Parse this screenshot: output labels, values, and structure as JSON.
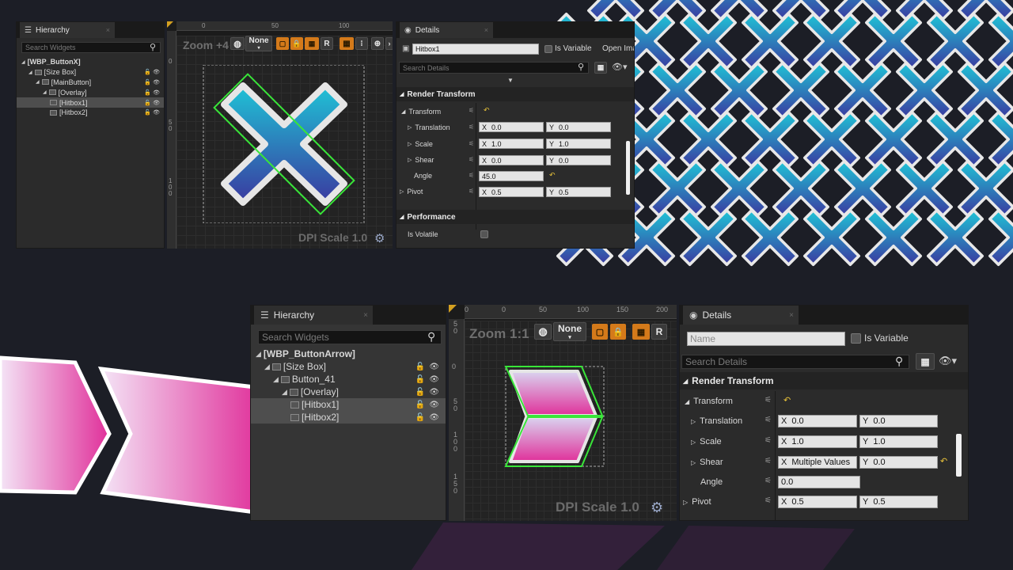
{
  "colors": {
    "accent": "#d47a1a",
    "hitbox": "#39e639",
    "reset": "#e8c23a",
    "x_cyan": "#1fc3d6",
    "x_indigo": "#3a3aa0",
    "arrow_pink": "#e0309a"
  },
  "top": {
    "hierarchy": {
      "tab": "Hierarchy",
      "search_placeholder": "Search Widgets",
      "items": [
        {
          "label": "[WBP_ButtonX]"
        },
        {
          "label": "[Size Box]"
        },
        {
          "label": "[MainButton]"
        },
        {
          "label": "[Overlay]"
        },
        {
          "label": "[Hitbox1]"
        },
        {
          "label": "[Hitbox2]"
        }
      ]
    },
    "designer": {
      "zoom": "Zoom +4",
      "none_label": "None",
      "r_label": "R",
      "ruler_top": [
        "0",
        "50",
        "100"
      ],
      "ruler_left": [
        "0",
        "5\n0",
        "1\n0\n0"
      ],
      "dpi": "DPI Scale 1.0"
    },
    "details": {
      "tab": "Details",
      "name_value": "Hitbox1",
      "is_variable": "Is Variable",
      "open_label": "Open Ima",
      "search_placeholder": "Search Details",
      "section_render": "Render Transform",
      "transform": "Transform",
      "translation": {
        "label": "Translation",
        "x": "0.0",
        "y": "0.0"
      },
      "scale": {
        "label": "Scale",
        "x": "1.0",
        "y": "1.0"
      },
      "shear": {
        "label": "Shear",
        "x": "0.0",
        "y": "0.0"
      },
      "angle": {
        "label": "Angle",
        "value": "45.0"
      },
      "pivot": {
        "label": "Pivot",
        "x": "0.5",
        "y": "0.5"
      },
      "section_performance": "Performance",
      "is_volatile": "Is Volatile",
      "x_axis": "X",
      "y_axis": "Y"
    }
  },
  "bottom": {
    "hierarchy": {
      "tab": "Hierarchy",
      "search_placeholder": "Search Widgets",
      "items": [
        {
          "label": "[WBP_ButtonArrow]"
        },
        {
          "label": "[Size Box]"
        },
        {
          "label": "Button_41"
        },
        {
          "label": "[Overlay]"
        },
        {
          "label": "[Hitbox1]"
        },
        {
          "label": "[Hitbox2]"
        }
      ]
    },
    "designer": {
      "zoom": "Zoom 1:1",
      "none_label": "None",
      "r_label": "R",
      "ruler_top": [
        "0",
        "0",
        "50",
        "100",
        "150",
        "200"
      ],
      "ruler_left": [
        "5\n0",
        "0",
        "5\n0",
        "1\n0\n0",
        "1\n5\n0"
      ],
      "dpi": "DPI Scale 1.0"
    },
    "details": {
      "tab": "Details",
      "name_placeholder": "Name",
      "is_variable": "Is Variable",
      "search_placeholder": "Search Details",
      "section_render": "Render Transform",
      "transform": "Transform",
      "translation": {
        "label": "Translation",
        "x": "0.0",
        "y": "0.0"
      },
      "scale": {
        "label": "Scale",
        "x": "1.0",
        "y": "1.0"
      },
      "shear": {
        "label": "Shear",
        "x": "Multiple Values",
        "y": "0.0"
      },
      "angle": {
        "label": "Angle",
        "value": "0.0"
      },
      "pivot": {
        "label": "Pivot",
        "x": "0.5",
        "y": "0.5"
      },
      "x_axis": "X",
      "y_axis": "Y"
    }
  }
}
